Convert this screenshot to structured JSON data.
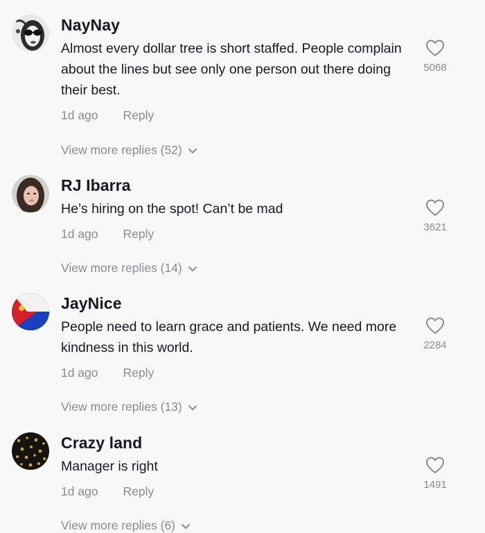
{
  "comments": [
    {
      "username": "NayNay",
      "text": "Almost every dollar tree is short staffed. People complain about the lines but see only one person out there doing their best.",
      "time": "1d ago",
      "reply_label": "Reply",
      "likes": "5068",
      "view_more": "View more replies (52)",
      "avatar_icon": "avatar-sunglasses-woman"
    },
    {
      "username": "RJ Ibarra",
      "text": "He’s hiring on the spot! Can’t be mad",
      "time": "1d ago",
      "reply_label": "Reply",
      "likes": "3621",
      "view_more": "View more replies (14)",
      "avatar_icon": "avatar-woman-photo"
    },
    {
      "username": "JayNice",
      "text": "People need to learn grace and patients. We need more kindness in this world.",
      "time": "1d ago",
      "reply_label": "Reply",
      "likes": "2284",
      "view_more": "View more replies (13)",
      "avatar_icon": "avatar-philippine-flag"
    },
    {
      "username": "Crazy land",
      "text": "Manager is right",
      "time": "1d ago",
      "reply_label": "Reply",
      "likes": "1491",
      "view_more": "View more replies (6)",
      "avatar_icon": "avatar-gold-hearts"
    }
  ],
  "colors": {
    "background": "#f8f8f8",
    "text_primary": "#161823",
    "text_secondary": "#8a8b91"
  }
}
